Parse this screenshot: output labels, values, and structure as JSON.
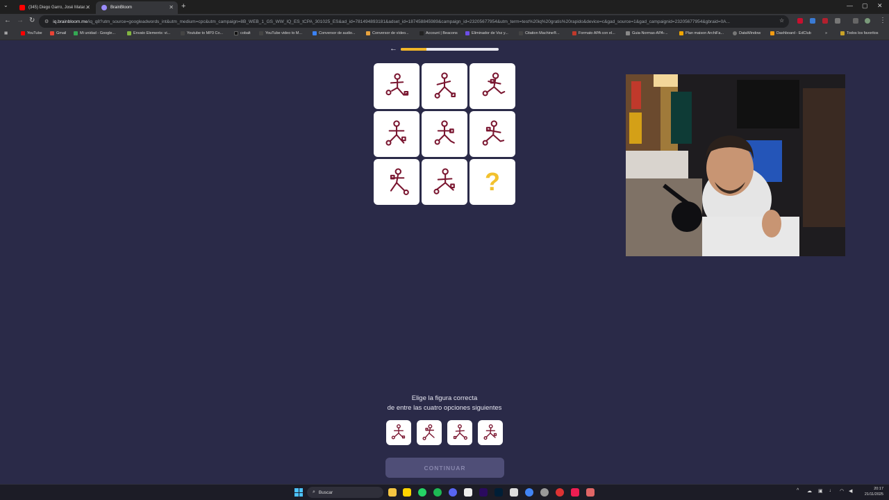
{
  "browser": {
    "tabs": [
      {
        "title": "(345) Diego Garro, José Matar..."
      },
      {
        "title": "BrainBloom"
      }
    ],
    "url_host": "iq.brainbloom.me",
    "url_rest": "/iq_q8?utm_source=googleadwords_int&utm_medium=cpc&utm_campaign=8B_WEB_1_GS_WW_IQ_ES_tCPA_301025_ES&ad_id=781494893181&adset_id=187458845989&campaign_id=23205677954&utm_term=test%20iq%20gratis%20rapido&device=c&gad_source=1&gad_campaignid=23205677954&gbraid=0A...",
    "bookmarks": [
      "YouTube",
      "Gmail",
      "Mi unidad - Google...",
      "Envato Elements: vi...",
      "Youtube to MP3 Co...",
      "cobalt",
      "YouTube video to M...",
      "Conversor de audio...",
      "Conversor de vídeo...",
      "Account | Beacons",
      "Eliminador de Voz y...",
      "Citation Machine®...",
      "Formato APA con el...",
      "Guia-Normas-APA-...",
      "Plan maison ArchiFa...",
      "DataWindow",
      "Dashboard - EdClub"
    ],
    "bookmarks_more": "»",
    "all_bookmarks": "Todos los favoritos"
  },
  "quiz": {
    "progress": 0.26,
    "missing_mark": "?",
    "prompt_line1": "Elige la figura correcta",
    "prompt_line2": "de entre las cuatro opciones siguientes",
    "continue_label": "CONTINUAR"
  },
  "taskbar": {
    "search_placeholder": "Buscar",
    "time": "20:17",
    "date": "21/11/2025"
  }
}
